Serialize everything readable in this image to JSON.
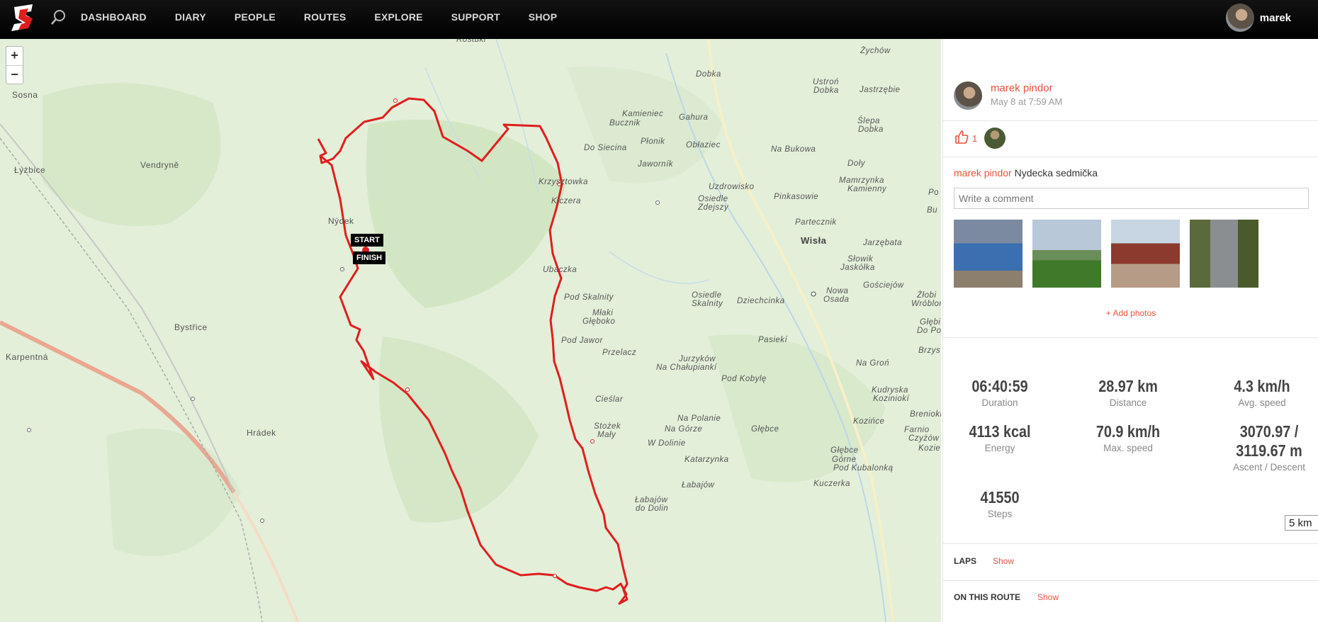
{
  "nav": {
    "items": [
      "DASHBOARD",
      "DIARY",
      "PEOPLE",
      "ROUTES",
      "EXPLORE",
      "SUPPORT",
      "SHOP"
    ],
    "user": "marek",
    "logo_icon": "sports-tracker-logo",
    "search_icon": "search-icon"
  },
  "map": {
    "zoom_in": "+",
    "zoom_out": "−",
    "start_label": "START",
    "finish_label": "FINISH",
    "route_color": "#e01e1e",
    "places": [
      "Rostuki",
      "Żychów",
      "Sosna",
      "Dobka",
      "Ustroń",
      "Dobka",
      "Jastrzębie",
      "Kamieniec",
      "Gahura",
      "Bucznik",
      "Ślepa",
      "Dobka",
      "Do Siecina",
      "Płonik",
      "Obłaziec",
      "Na Bukowa",
      "Łyżbice",
      "Vendryně",
      "Jaworník",
      "Doły",
      "Mamrzynka",
      "Kamienny",
      "Krzysztowka",
      "Uzdrowisko",
      "Osiedle",
      "Zdejszy",
      "Pinkasowie",
      "Kiczera",
      "Nýdek",
      "Partecznik",
      "Wisła",
      "Jarzębata",
      "Ubaczka",
      "Słowik",
      "Jaskółka",
      "Pod Skalnity",
      "Osiedle",
      "Skalnity",
      "Dziechcinka",
      "Nowa",
      "Osada",
      "Gościejów",
      "Młaki",
      "Głęboko",
      "Bystřice",
      "Pod Jawor",
      "Przelacz",
      "Pasiekí",
      "Karpentná",
      "Jurzyków",
      "Na Chałupiankí",
      "Na Groń",
      "Pod Kobylę",
      "Cieślar",
      "Kudryska",
      "Koziniokí",
      "Na Polanie",
      "Na Górze",
      "Głębce",
      "Stożek",
      "Mały",
      "Hrádek",
      "W Dolinie",
      "Kozińce",
      "Katarzynka",
      "Głębce",
      "Górne",
      "Pod Kubalonką",
      "Łabajów",
      "Kuczerka",
      "Łabajów",
      "do Dolin",
      "Żłobi",
      "Wróblonki",
      "Głębie",
      "Do Poto",
      "Brzys",
      "Brenioki",
      "Farnio",
      "Czyżów",
      "Po",
      "Bu",
      "Kozie"
    ]
  },
  "post": {
    "author": "marek pindor",
    "date": "May 8 at 7:59 AM",
    "like_count": "1",
    "description": "Nydecka sedmička",
    "comment_placeholder": "Write a comment",
    "add_photos": "+ Add photos"
  },
  "stats": [
    {
      "value": "06:40:59",
      "label": "Duration"
    },
    {
      "value": "28.97 km",
      "label": "Distance"
    },
    {
      "value": "4.3 km/h",
      "label": "Avg. speed"
    },
    {
      "value": "4113 kcal",
      "label": "Energy"
    },
    {
      "value": "70.9 km/h",
      "label": "Max. speed"
    },
    {
      "value": "3070.97 / 3119.67 m",
      "label": "Ascent / Descent"
    },
    {
      "value": "41550",
      "label": "Steps"
    }
  ],
  "laps": {
    "title": "LAPS",
    "show": "Show",
    "select_value": "5 km"
  },
  "on_route": {
    "title": "ON THIS ROUTE",
    "show": "Show"
  }
}
